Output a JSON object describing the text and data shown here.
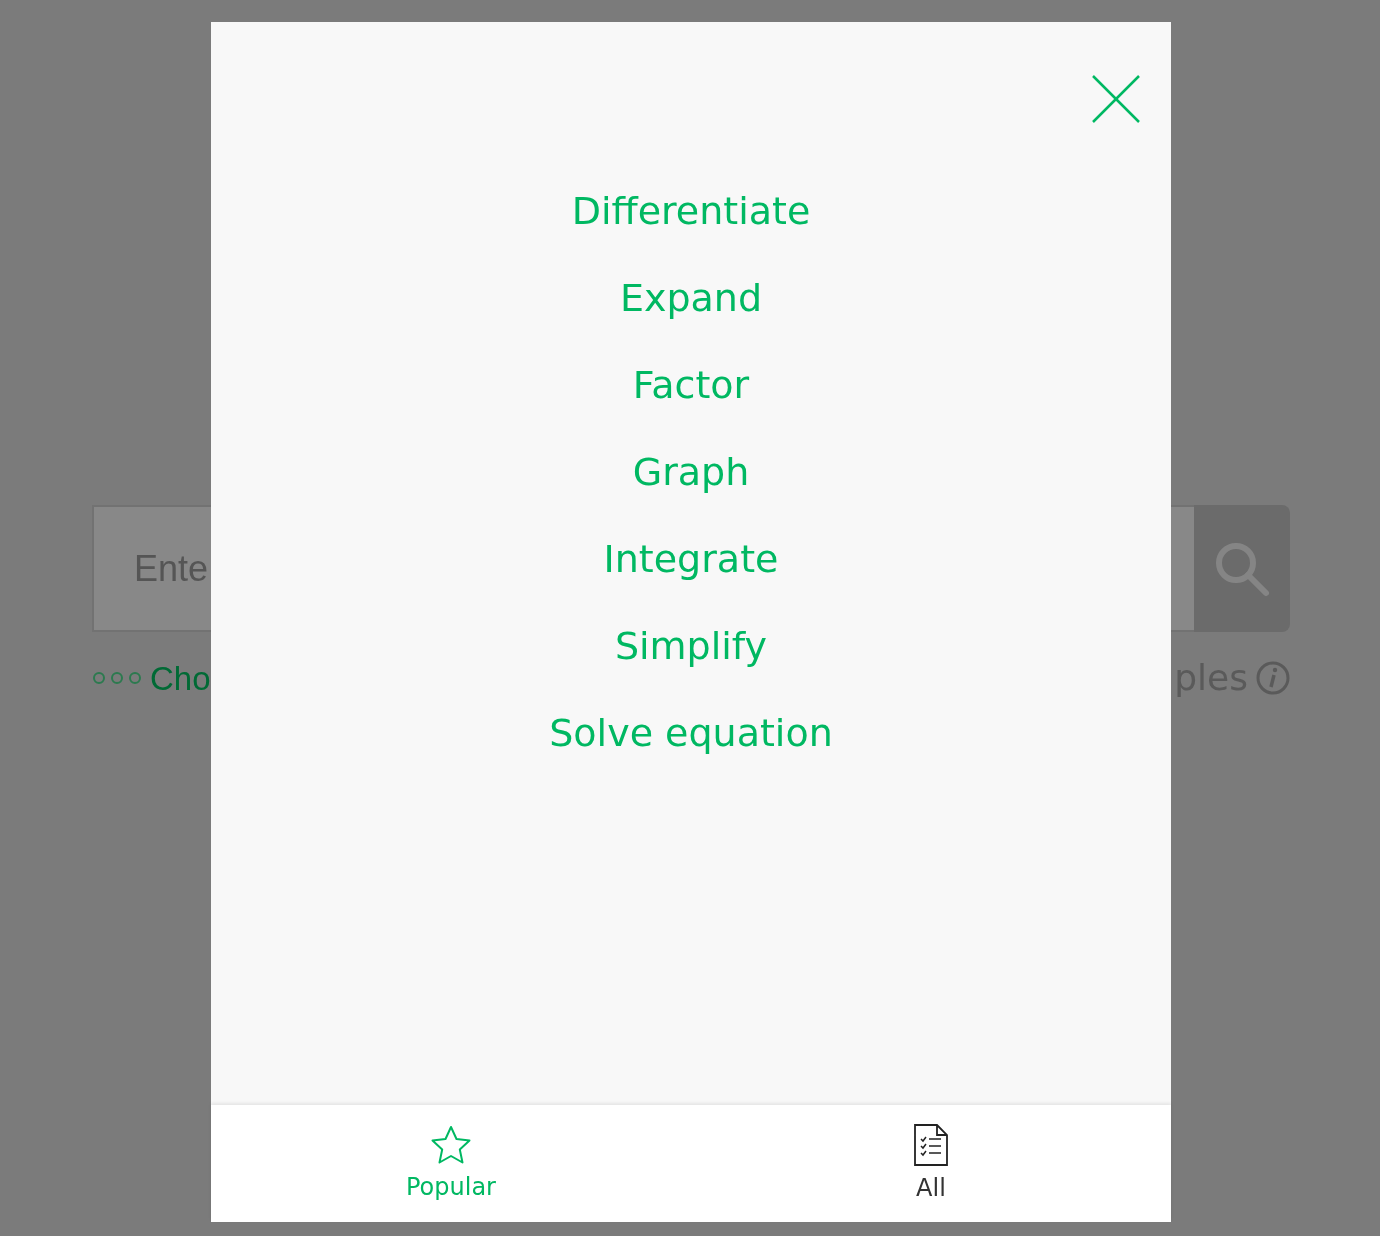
{
  "background": {
    "search_field": {
      "placeholder": "Ente"
    },
    "options_link": "Cho",
    "examples_link": "ples"
  },
  "modal": {
    "items": [
      {
        "label": "Differentiate"
      },
      {
        "label": "Expand"
      },
      {
        "label": "Factor"
      },
      {
        "label": "Graph"
      },
      {
        "label": "Integrate"
      },
      {
        "label": "Simplify"
      },
      {
        "label": "Solve equation"
      }
    ],
    "tabs": [
      {
        "label": "Popular",
        "kind": "star",
        "selected": true
      },
      {
        "label": "All",
        "kind": "list",
        "selected": false
      }
    ]
  }
}
